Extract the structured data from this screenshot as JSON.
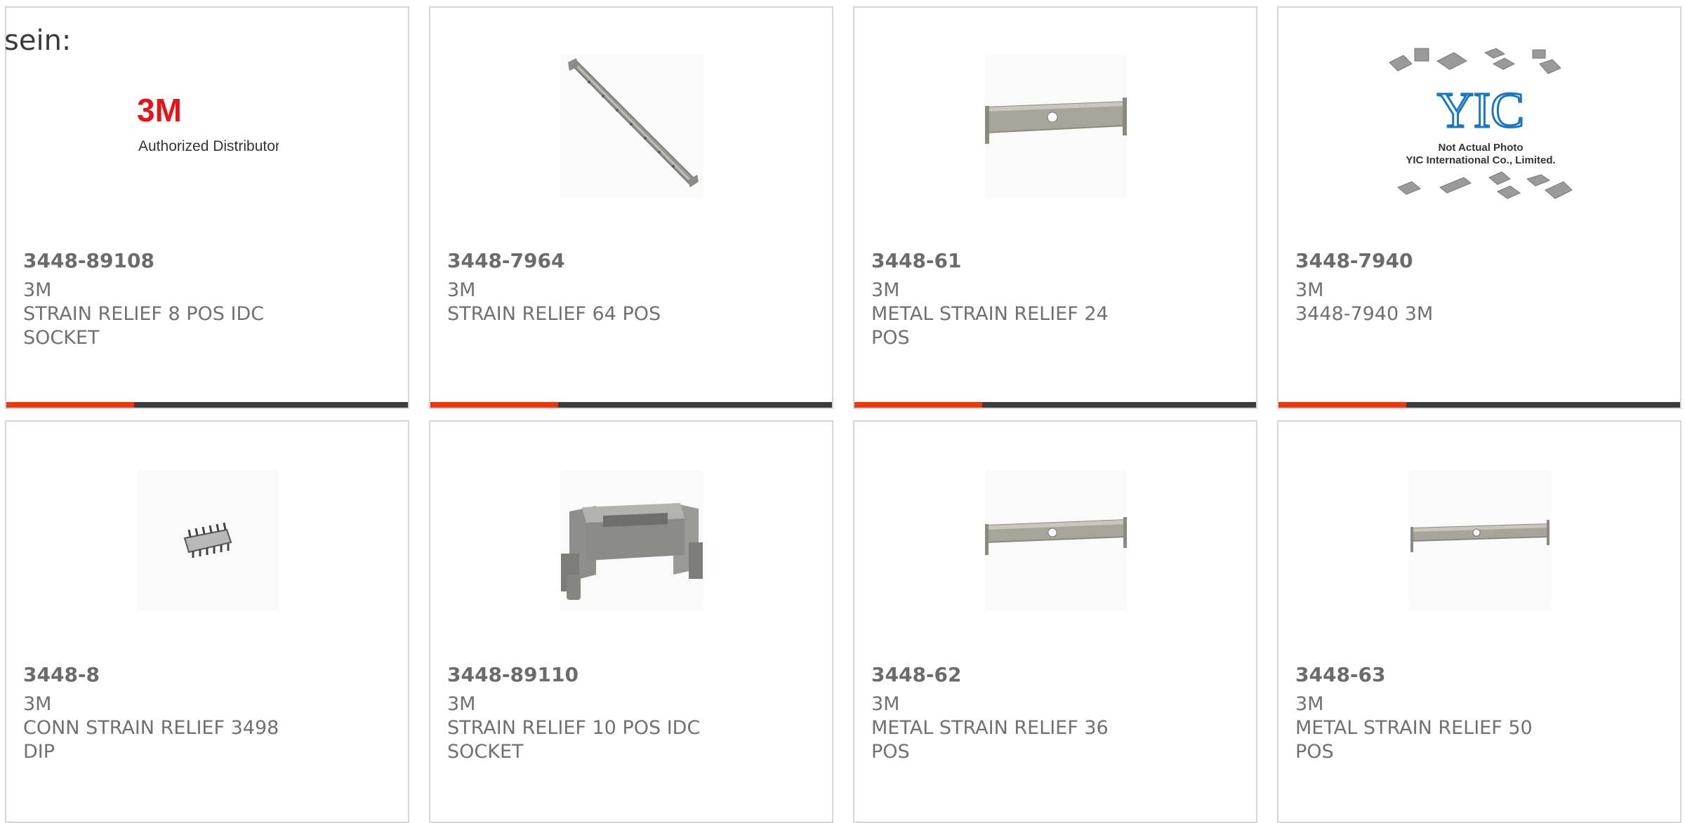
{
  "intro_text": "sein:",
  "colors": {
    "accent": "#e33b12",
    "bar": "#3d3d3d",
    "border": "#d6d6d6"
  },
  "products": [
    {
      "part": "3448-89108",
      "manufacturer": "3M",
      "description": "STRAIN RELIEF 8 POS IDC SOCKET",
      "image": "3m-authorized-distributor-logo",
      "logo_text": "3M",
      "logo_subtext": "Authorized Distributor"
    },
    {
      "part": "3448-7964",
      "manufacturer": "3M",
      "description": "STRAIN RELIEF 64 POS",
      "image": "long-strain-relief-bar"
    },
    {
      "part": "3448-61",
      "manufacturer": "3M",
      "description": "METAL STRAIN RELIEF 24 POS",
      "image": "metal-strain-relief"
    },
    {
      "part": "3448-7940",
      "manufacturer": "3M",
      "description": "3448-7940 3M",
      "image": "yic-placeholder",
      "placeholder_logo": "YIC",
      "placeholder_line1": "Not Actual Photo",
      "placeholder_line2": "YIC International Co., Limited."
    },
    {
      "part": "3448-8",
      "manufacturer": "3M",
      "description": "CONN STRAIN RELIEF 3498 DIP",
      "image": "dip-connector"
    },
    {
      "part": "3448-89110",
      "manufacturer": "3M",
      "description": "STRAIN RELIEF 10 POS IDC SOCKET",
      "image": "gray-strain-relief-clip"
    },
    {
      "part": "3448-62",
      "manufacturer": "3M",
      "description": "METAL STRAIN RELIEF 36 POS",
      "image": "metal-strain-relief"
    },
    {
      "part": "3448-63",
      "manufacturer": "3M",
      "description": "METAL STRAIN RELIEF 50 POS",
      "image": "metal-strain-relief"
    }
  ]
}
